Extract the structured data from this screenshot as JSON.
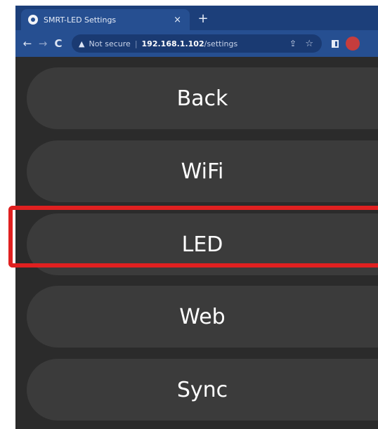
{
  "browser": {
    "tab_title": "SMRT-LED Settings",
    "tab_close": "×",
    "new_tab": "+",
    "security_label": "Not secure",
    "separator": "|",
    "url_host": "192.168.1.102",
    "url_path": "/settings"
  },
  "menu": {
    "items": [
      {
        "label": "Back"
      },
      {
        "label": "WiFi"
      },
      {
        "label": "LED"
      },
      {
        "label": "Web"
      },
      {
        "label": "Sync"
      }
    ]
  },
  "colors": {
    "highlight": "#e02020",
    "button_bg": "#3b3b3b",
    "page_bg": "#2b2b2b",
    "browser_chrome": "#264f91"
  },
  "icons": [
    "favicon-icon",
    "back-arrow-icon",
    "forward-arrow-icon",
    "reload-icon",
    "warning-icon",
    "share-icon",
    "star-icon",
    "sidepanel-icon",
    "profile-icon"
  ]
}
